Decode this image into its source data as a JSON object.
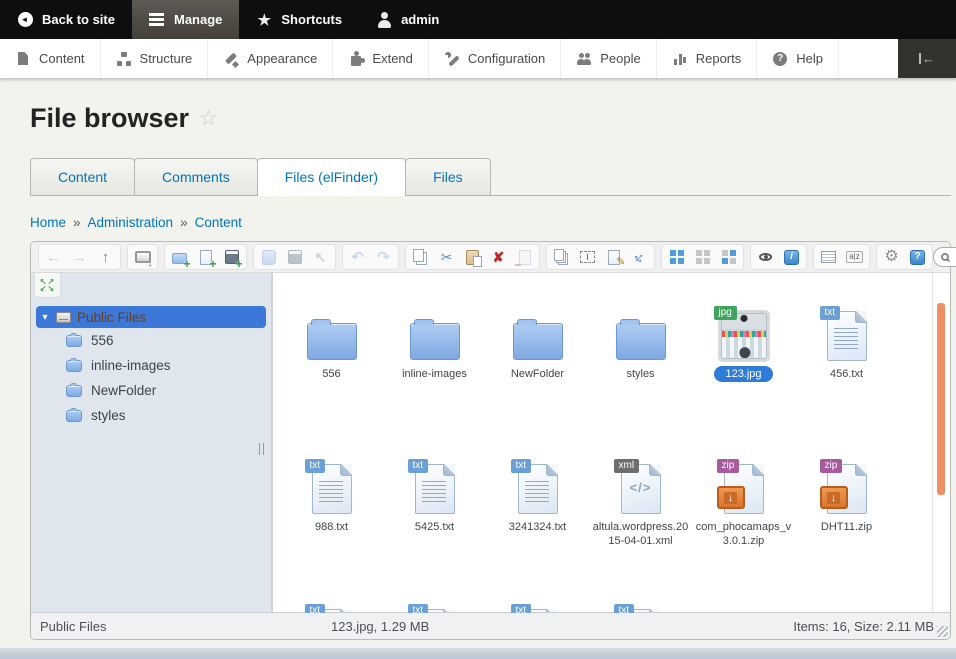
{
  "admin_bar": {
    "items": [
      {
        "label": "Back to site",
        "icon": "back-circle",
        "active": false
      },
      {
        "label": "Manage",
        "icon": "hamburger",
        "active": true
      },
      {
        "label": "Shortcuts",
        "icon": "star",
        "active": false
      },
      {
        "label": "admin",
        "icon": "user",
        "active": false
      }
    ]
  },
  "admin_menu": {
    "items": [
      {
        "label": "Content",
        "icon": "content"
      },
      {
        "label": "Structure",
        "icon": "structure"
      },
      {
        "label": "Appearance",
        "icon": "appearance"
      },
      {
        "label": "Extend",
        "icon": "extend"
      },
      {
        "label": "Configuration",
        "icon": "configuration"
      },
      {
        "label": "People",
        "icon": "people"
      },
      {
        "label": "Reports",
        "icon": "reports"
      },
      {
        "label": "Help",
        "icon": "help"
      }
    ]
  },
  "page": {
    "title": "File browser",
    "title_star": "☆"
  },
  "tabs": {
    "items": [
      {
        "label": "Content",
        "active": false
      },
      {
        "label": "Comments",
        "active": false
      },
      {
        "label": "Files (elFinder)",
        "active": true
      },
      {
        "label": "Files",
        "active": false
      }
    ]
  },
  "breadcrumb": {
    "separator": "»",
    "items": [
      {
        "label": "Home"
      },
      {
        "label": "Administration"
      },
      {
        "label": "Content"
      }
    ]
  },
  "elfinder": {
    "toolbar": {
      "groups": [
        {
          "buttons": [
            {
              "name": "back",
              "disabled": true
            },
            {
              "name": "forward",
              "disabled": true
            },
            {
              "name": "up",
              "disabled": false
            }
          ]
        },
        {
          "buttons": [
            {
              "name": "home",
              "disabled": false
            }
          ]
        },
        {
          "buttons": [
            {
              "name": "new-folder",
              "disabled": false
            },
            {
              "name": "new-file",
              "disabled": false
            },
            {
              "name": "upload",
              "disabled": false
            }
          ]
        },
        {
          "buttons": [
            {
              "name": "open",
              "disabled": true
            },
            {
              "name": "save",
              "disabled": true
            },
            {
              "name": "get-file",
              "disabled": true
            }
          ]
        },
        {
          "buttons": [
            {
              "name": "undo",
              "disabled": true
            },
            {
              "name": "redo",
              "disabled": true
            }
          ]
        },
        {
          "buttons": [
            {
              "name": "copy",
              "disabled": false
            },
            {
              "name": "cut",
              "disabled": false
            },
            {
              "name": "paste",
              "disabled": false
            },
            {
              "name": "delete",
              "disabled": false
            },
            {
              "name": "clear",
              "disabled": true
            }
          ]
        },
        {
          "buttons": [
            {
              "name": "duplicate",
              "disabled": false
            },
            {
              "name": "rename",
              "disabled": false
            },
            {
              "name": "edit",
              "disabled": false
            },
            {
              "name": "resize",
              "disabled": false
            }
          ]
        },
        {
          "buttons": [
            {
              "name": "view-icons",
              "disabled": false,
              "active": true
            },
            {
              "name": "view-list",
              "disabled": false
            },
            {
              "name": "view-compact",
              "disabled": false
            }
          ]
        },
        {
          "buttons": [
            {
              "name": "preview",
              "disabled": false
            },
            {
              "name": "info",
              "disabled": false
            }
          ]
        },
        {
          "buttons": [
            {
              "name": "details",
              "disabled": false
            },
            {
              "name": "sort",
              "disabled": false
            }
          ]
        },
        {
          "buttons": [
            {
              "name": "preferences",
              "disabled": false
            },
            {
              "name": "help",
              "disabled": false
            }
          ]
        }
      ],
      "search": {
        "value": "",
        "placeholder": ""
      }
    },
    "nav": {
      "root": {
        "label": "Public Files",
        "selected": true
      },
      "folders": [
        {
          "label": "556"
        },
        {
          "label": "inline-images"
        },
        {
          "label": "NewFolder"
        },
        {
          "label": "styles"
        }
      ]
    },
    "files": {
      "rows": [
        [
          {
            "name": "556",
            "type": "folder"
          },
          {
            "name": "inline-images",
            "type": "folder"
          },
          {
            "name": "NewFolder",
            "type": "folder"
          },
          {
            "name": "styles",
            "type": "folder"
          },
          {
            "name": "123.jpg",
            "type": "image",
            "badge": "jpg",
            "selected": true
          },
          {
            "name": "456.txt",
            "type": "txt",
            "badge": "txt"
          }
        ],
        [
          {
            "name": "988.txt",
            "type": "txt",
            "badge": "txt"
          },
          {
            "name": "5425.txt",
            "type": "txt",
            "badge": "txt"
          },
          {
            "name": "3241324.txt",
            "type": "txt",
            "badge": "txt"
          },
          {
            "name": "altula.wordpress.2015-04-01.xml",
            "type": "xml",
            "badge": "xml"
          },
          {
            "name": "com_phocamaps_v3.0.1.zip",
            "type": "zip",
            "badge": "zip"
          },
          {
            "name": "DHT11.zip",
            "type": "zip",
            "badge": "zip"
          }
        ],
        [
          {
            "name": "",
            "type": "txt",
            "badge": "txt",
            "partial": true
          },
          {
            "name": "",
            "type": "txt",
            "badge": "txt",
            "partial": true
          },
          {
            "name": "",
            "type": "txt",
            "badge": "txt",
            "partial": true
          },
          {
            "name": "",
            "type": "txt",
            "badge": "txt",
            "partial": true
          }
        ]
      ]
    },
    "statusbar": {
      "left": "Public Files",
      "center": "123.jpg, 1.29 MB",
      "right": "Items: 16, Size: 2.11 MB"
    }
  },
  "colors": {
    "link": "#0074bd",
    "selection_blue": "#3b78d8",
    "selected_label_pill": "#2e7bd8",
    "scrollbar_thumb": "#ef8e63",
    "badge_jpg": "#3fa45c",
    "badge_txt": "#6b9fd8",
    "badge_xml": "#6e6e6e",
    "badge_zip": "#a85a9e"
  }
}
